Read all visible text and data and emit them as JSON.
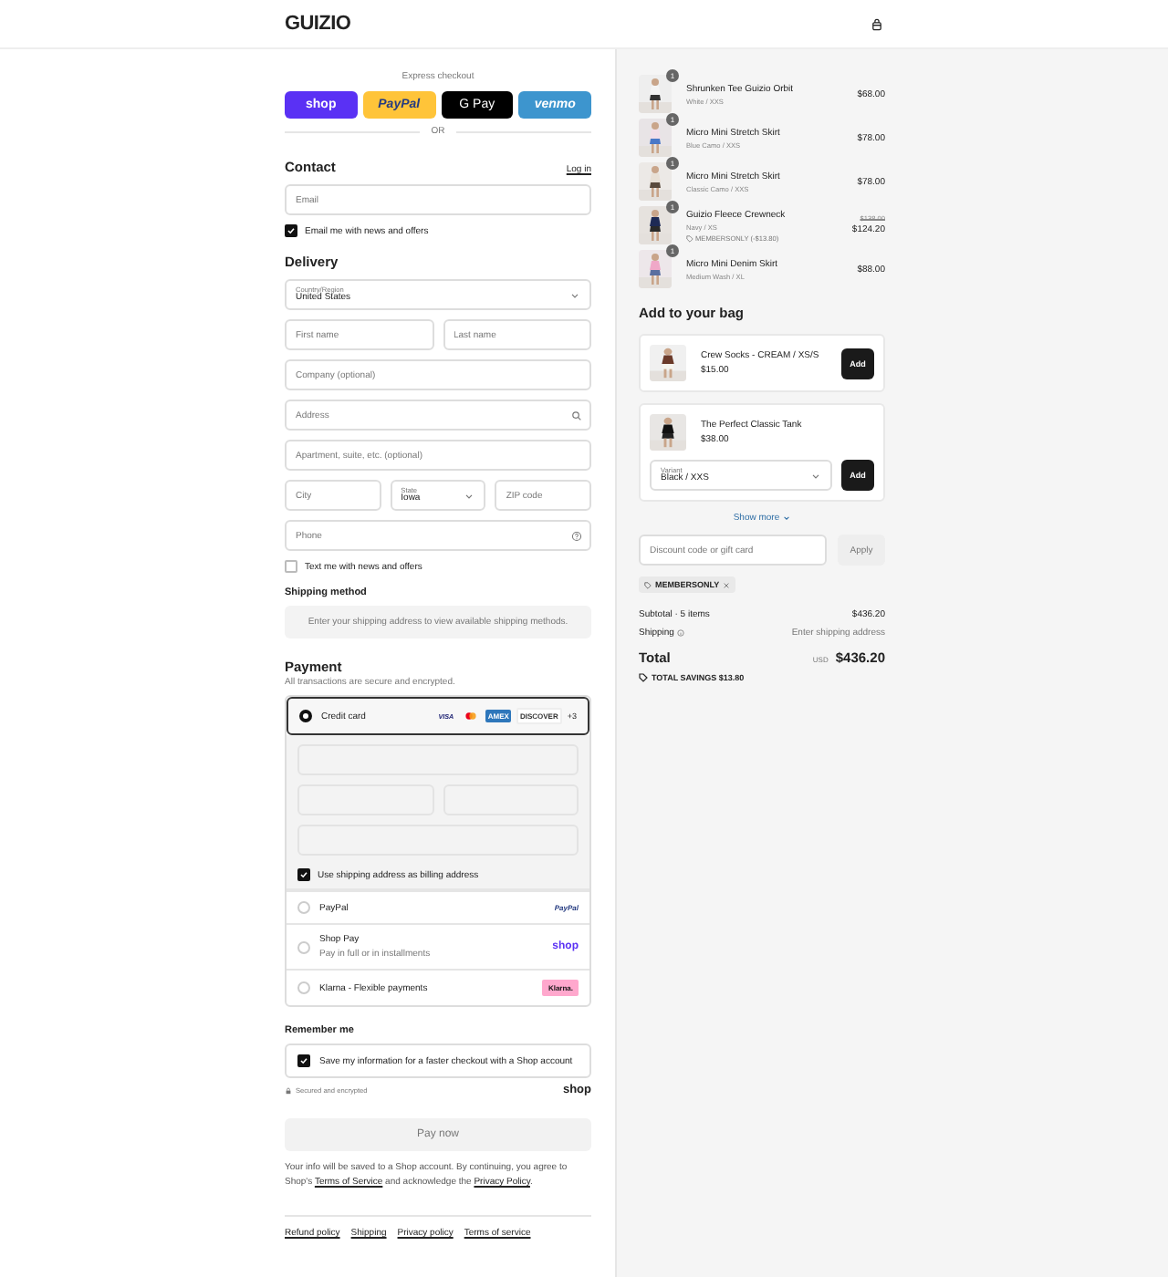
{
  "header": {
    "logo": "GUIZIO"
  },
  "express_checkout": {
    "label": "Express checkout",
    "buttons": [
      {
        "kind": "shop",
        "label": "shop"
      },
      {
        "kind": "paypal",
        "label": "PayPal"
      },
      {
        "kind": "gpay",
        "label": "G Pay"
      },
      {
        "kind": "venmo",
        "label": "venmo"
      }
    ],
    "divider": "OR"
  },
  "contact": {
    "title": "Contact",
    "login_link": "Log in",
    "email": {
      "placeholder": "Email"
    },
    "newsletter": {
      "label": "Email me with news and offers",
      "checked": true
    }
  },
  "delivery": {
    "title": "Delivery",
    "country": {
      "label": "Country/Region",
      "value": "United States"
    },
    "first_name": {
      "placeholder": "First name"
    },
    "last_name": {
      "placeholder": "Last name"
    },
    "company": {
      "placeholder": "Company (optional)"
    },
    "address": {
      "placeholder": "Address"
    },
    "apartment": {
      "placeholder": "Apartment, suite, etc. (optional)"
    },
    "city": {
      "placeholder": "City"
    },
    "state": {
      "label": "State",
      "value": "Iowa"
    },
    "zip": {
      "placeholder": "ZIP code"
    },
    "phone": {
      "placeholder": "Phone"
    },
    "sms": {
      "label": "Text me with news and offers",
      "checked": false
    }
  },
  "shipping_method": {
    "title": "Shipping method",
    "message": "Enter your shipping address to view available shipping methods."
  },
  "payment": {
    "title": "Payment",
    "subtitle": "All transactions are secure and encrypted.",
    "options": [
      {
        "kind": "card",
        "label": "Credit card",
        "selected": true,
        "brands": [
          {
            "kind": "visa",
            "label": "VISA"
          },
          {
            "kind": "mastercard"
          },
          {
            "kind": "amex",
            "label": "AMEX"
          },
          {
            "kind": "discover",
            "label": "DISCOVER"
          }
        ],
        "more": "+3",
        "billing": {
          "label": "Use shipping address as billing address",
          "checked": true
        }
      },
      {
        "kind": "paypal",
        "label": "PayPal",
        "selected": false,
        "logo": "PayPal"
      },
      {
        "kind": "shoppay",
        "label": "Shop Pay",
        "selected": false,
        "note": "Pay in full or in installments",
        "logo": "shop"
      },
      {
        "kind": "klarna",
        "label": "Klarna - Flexible payments",
        "selected": false,
        "logo": "Klarna."
      }
    ]
  },
  "remember_me": {
    "title": "Remember me",
    "save": {
      "label": "Save my information for a faster checkout with a Shop account",
      "checked": true
    },
    "secure_note": "Secured and encrypted",
    "shop_logo": "shop"
  },
  "pay_button": {
    "label": "Pay now",
    "disabled": true
  },
  "legal": {
    "text_1": "Your info will be saved to a Shop account. By continuing, you agree to Shop's ",
    "terms_link": "Terms of Service",
    "text_2": " and acknowledge the ",
    "privacy_link": "Privacy Policy",
    "text_3": "."
  },
  "footer_links": [
    "Refund policy",
    "Shipping",
    "Privacy policy",
    "Terms of service"
  ],
  "order_summary": {
    "items": [
      {
        "name": "Shrunken Tee Guizio Orbit",
        "variant": "White / XXS",
        "price": "$68.00",
        "quantity": "1"
      },
      {
        "name": "Micro Mini Stretch Skirt",
        "variant": "Blue Camo / XXS",
        "price": "$78.00",
        "quantity": "1"
      },
      {
        "name": "Micro Mini Stretch Skirt",
        "variant": "Classic Camo / XXS",
        "price": "$78.00",
        "quantity": "1"
      },
      {
        "name": "Guizio Fleece Crewneck",
        "variant": "Navy / XS",
        "price": "$124.20",
        "original_price": "$138.00",
        "discount": "MEMBERSONLY (-$13.80)",
        "quantity": "1"
      },
      {
        "name": "Micro Mini Denim Skirt",
        "variant": "Medium Wash / XL",
        "price": "$88.00",
        "quantity": "1"
      }
    ],
    "upsell": {
      "title": "Add to your bag",
      "products": [
        {
          "name": "Crew Socks - CREAM / XS/S",
          "price": "$15.00",
          "button": "Add"
        },
        {
          "name": "The Perfect Classic Tank",
          "price": "$38.00",
          "variant": {
            "label": "Variant",
            "value": "Black / XXS"
          },
          "button": "Add"
        }
      ],
      "show_more": "Show more"
    },
    "discount": {
      "placeholder": "Discount code or gift card",
      "button": "Apply",
      "applied_codes": [
        "MEMBERSONLY"
      ]
    },
    "subtotal": {
      "label": "Subtotal · 5 items",
      "value": "$436.20"
    },
    "shipping": {
      "label": "Shipping",
      "value": "Enter shipping address"
    },
    "total": {
      "label": "Total",
      "currency": "USD",
      "value": "$436.20"
    },
    "savings": "TOTAL SAVINGS $13.80"
  }
}
